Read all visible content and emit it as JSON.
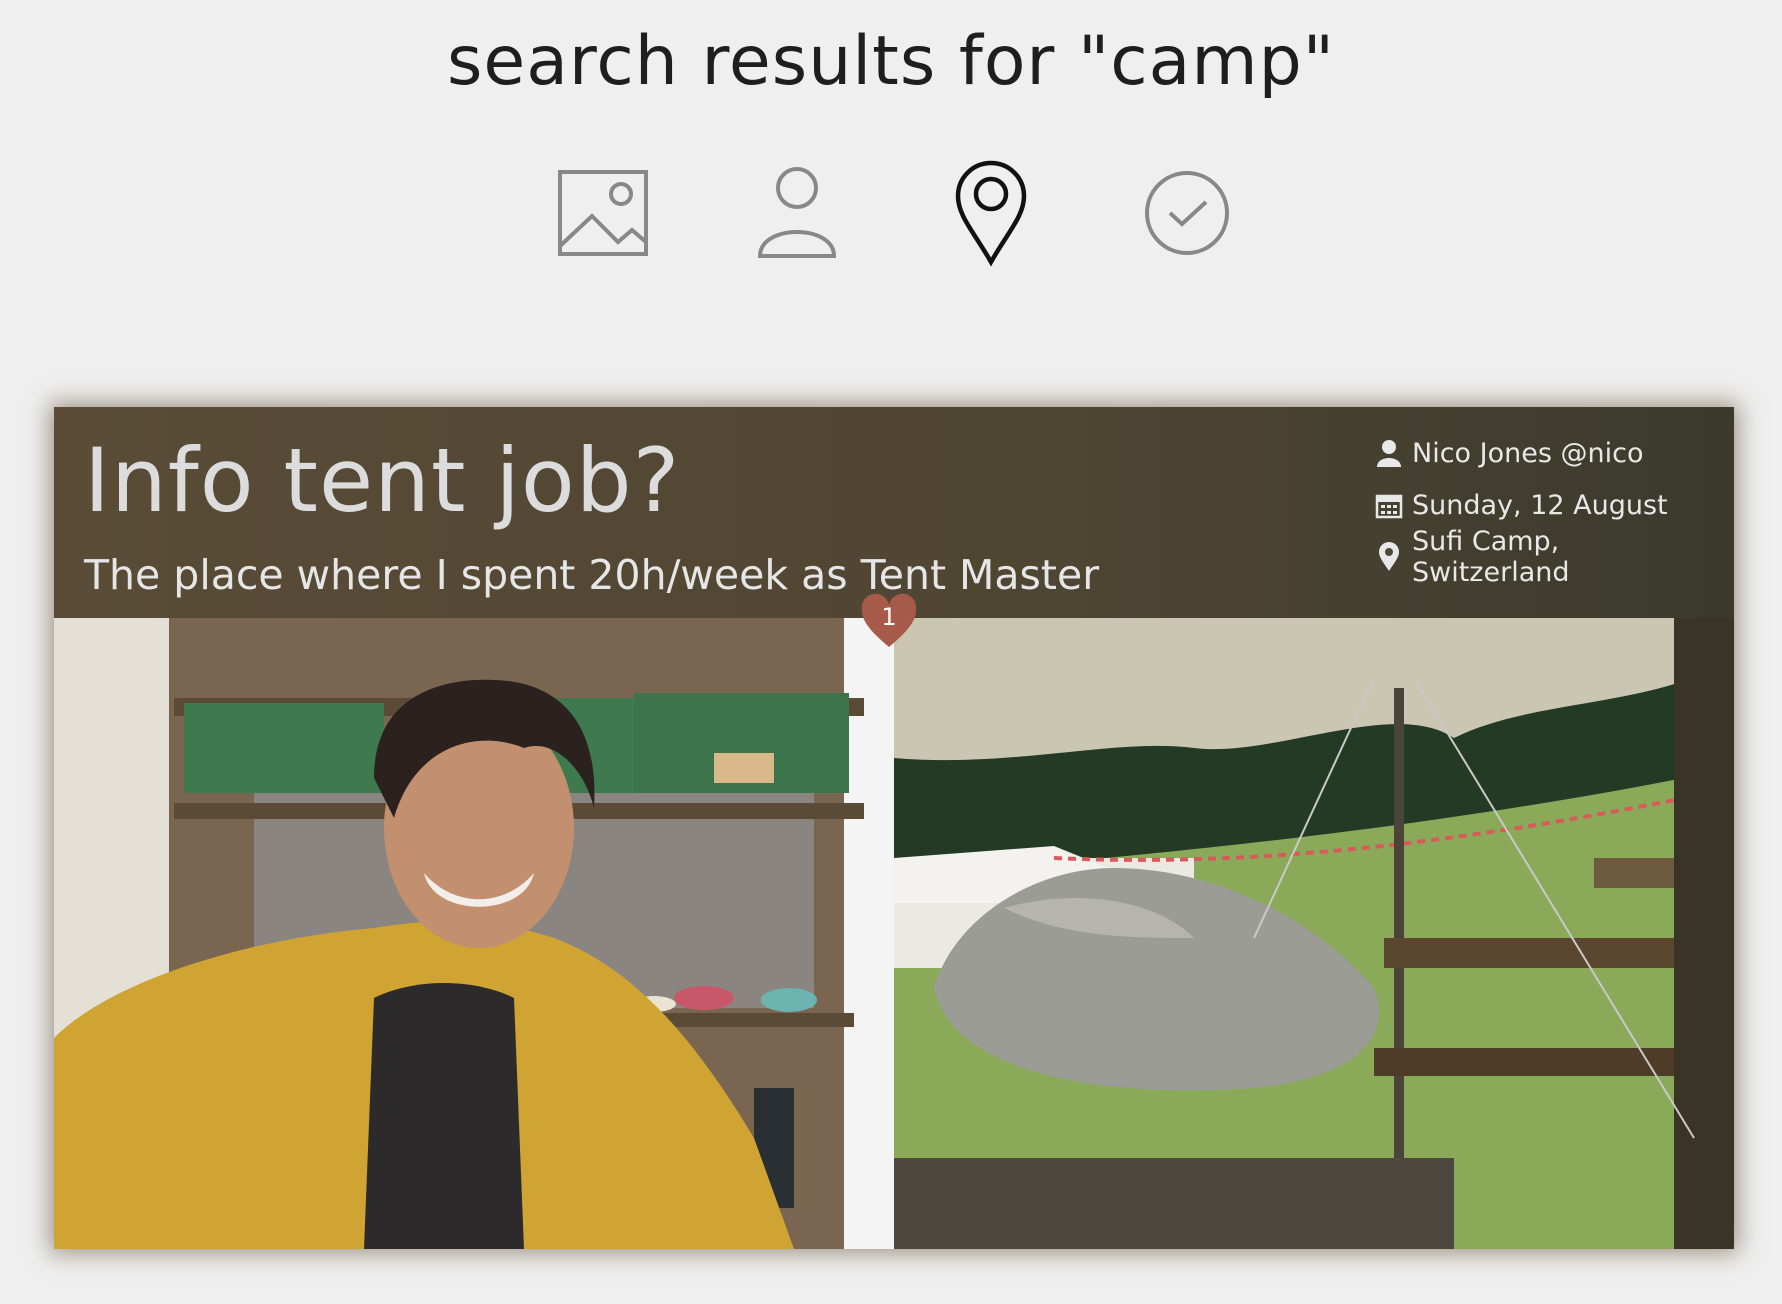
{
  "header": {
    "title": "search results for \"camp\""
  },
  "filters": [
    {
      "name": "photos",
      "icon": "image-icon",
      "active": false
    },
    {
      "name": "people",
      "icon": "person-icon",
      "active": false
    },
    {
      "name": "places",
      "icon": "map-pin-icon",
      "active": true
    },
    {
      "name": "tasks",
      "icon": "check-circle-icon",
      "active": false
    }
  ],
  "post": {
    "title": "Info tent job?",
    "subtitle": "The place where I spent 20h/week as Tent Master",
    "author": "Nico Jones @nico",
    "date": "Sunday, 12 August",
    "location": "Sufi Camp, Switzerland",
    "likes": "1",
    "photos": [
      {
        "description": "selfie-yellow-raincoat"
      },
      {
        "description": "tent-view-with-rock-and-meadow"
      }
    ]
  },
  "colors": {
    "header_bg": "#4f4735",
    "like_heart": "#a85a4a",
    "background": "#efefef"
  }
}
